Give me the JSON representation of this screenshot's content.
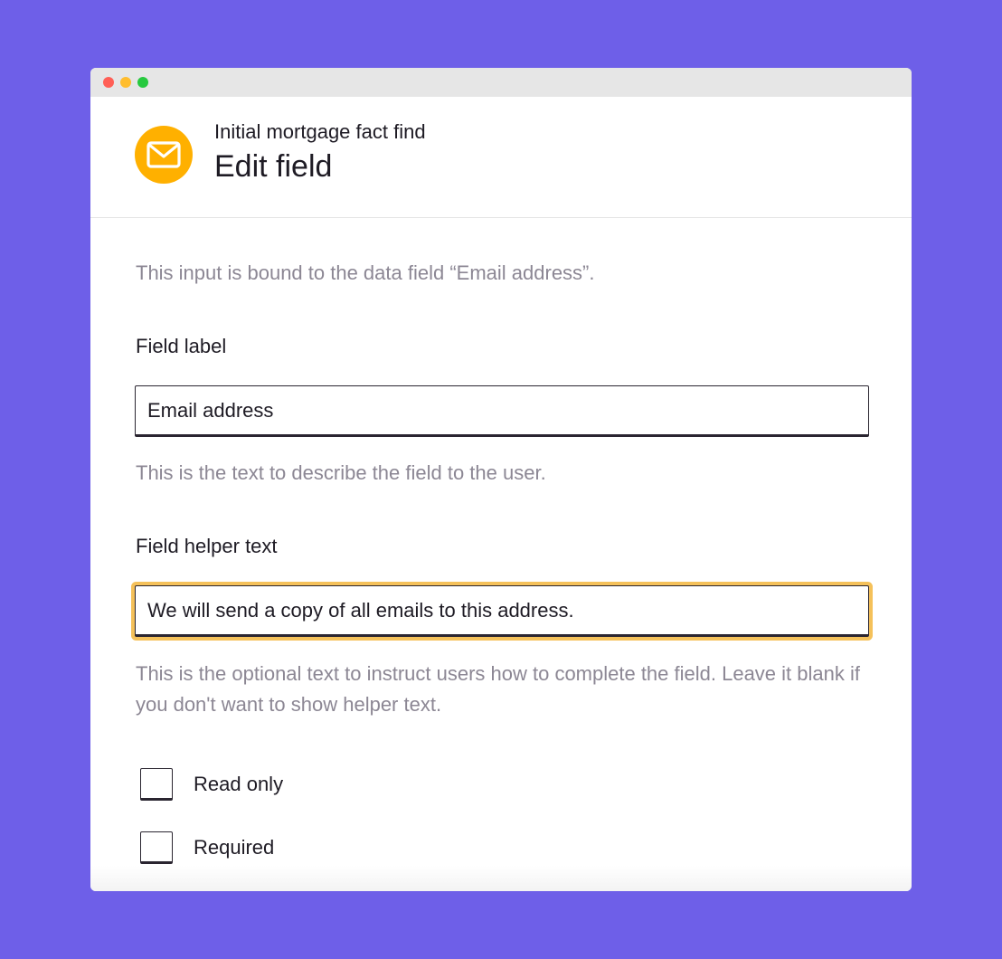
{
  "header": {
    "icon": "envelope-icon",
    "subtitle": "Initial mortgage fact find",
    "title": "Edit field"
  },
  "intro_text": "This input is bound to the data field “Email address”.",
  "field_label": {
    "label": "Field label",
    "value": "Email address",
    "help": "This is the text to describe the field to the user."
  },
  "field_helper": {
    "label": "Field helper text",
    "value": "We will send a copy of all emails to this address.",
    "help": "This is the optional text to instruct users how to complete the field. Leave it blank if you don't want to show helper text."
  },
  "options": {
    "read_only": {
      "label": "Read only",
      "checked": false
    },
    "required": {
      "label": "Required",
      "checked": false
    }
  },
  "colors": {
    "background": "#6e5fe8",
    "icon_accent": "#ffb000",
    "focus_ring": "#f5c15a"
  }
}
